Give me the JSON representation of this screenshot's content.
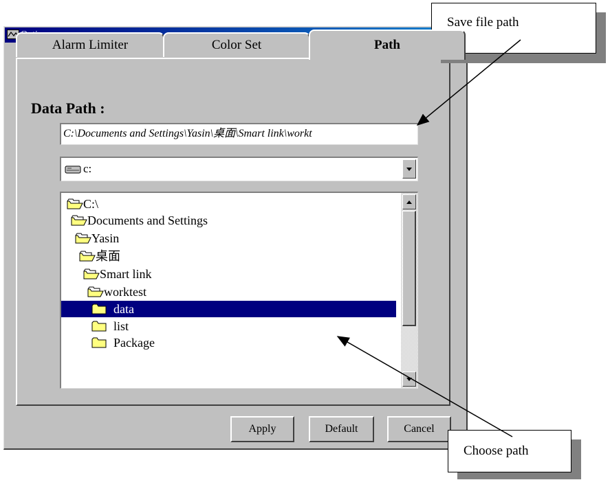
{
  "window": {
    "title": "Option"
  },
  "tabs": [
    {
      "label": "Alarm Limiter"
    },
    {
      "label": "Color Set"
    },
    {
      "label": "Path",
      "active": true
    }
  ],
  "data_path": {
    "label": "Data Path :",
    "value": "C:\\Documents and Settings\\Yasin\\桌面\\Smart link\\workt"
  },
  "drive": {
    "selected": "c:",
    "icon": "drive-icon"
  },
  "directories": [
    {
      "label": "C:\\",
      "icon": "open-folder-icon"
    },
    {
      "label": "Documents and Settings",
      "icon": "open-folder-icon"
    },
    {
      "label": "Yasin",
      "icon": "open-folder-icon"
    },
    {
      "label": "桌面",
      "icon": "open-folder-icon"
    },
    {
      "label": "Smart link",
      "icon": "open-folder-icon"
    },
    {
      "label": "worktest",
      "icon": "open-folder-icon"
    },
    {
      "label": "data",
      "icon": "closed-folder-icon",
      "selected": true
    },
    {
      "label": "list",
      "icon": "closed-folder-icon"
    },
    {
      "label": "Package",
      "icon": "closed-folder-icon"
    }
  ],
  "buttons": {
    "apply": "Apply",
    "default": "Default",
    "cancel": "Cancel"
  },
  "annotations": {
    "save": "Save file path",
    "choose": "Choose path"
  },
  "colors": {
    "titlebar": "#000080",
    "selection": "#000080",
    "dialog_face": "#c0c0c0"
  }
}
